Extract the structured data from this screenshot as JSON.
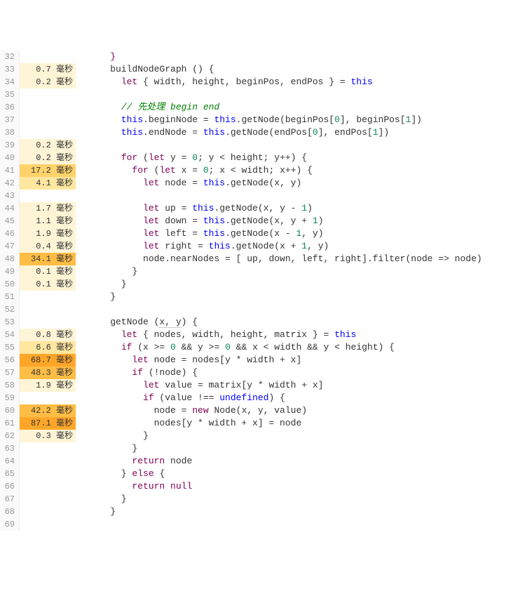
{
  "timing_unit": "毫秒",
  "lines": [
    {
      "n": 32,
      "t": null,
      "heat": 0,
      "tokens": [
        [
          "kw",
          "    }"
        ]
      ]
    },
    {
      "n": 33,
      "t": "0.7",
      "heat": 1,
      "tokens": [
        [
          "id",
          "    buildNodeGraph () {"
        ]
      ]
    },
    {
      "n": 34,
      "t": "0.2",
      "heat": 1,
      "tokens": [
        [
          "plain",
          "      "
        ],
        [
          "kw",
          "let"
        ],
        [
          "plain",
          " { width, height, beginPos, endPos } = "
        ],
        [
          "kw2",
          "this"
        ]
      ]
    },
    {
      "n": 35,
      "t": null,
      "heat": 0,
      "tokens": []
    },
    {
      "n": 36,
      "t": null,
      "heat": 0,
      "tokens": [
        [
          "plain",
          "      "
        ],
        [
          "cmt",
          "// 先处理 begin end"
        ]
      ]
    },
    {
      "n": 37,
      "t": null,
      "heat": 0,
      "tokens": [
        [
          "plain",
          "      "
        ],
        [
          "kw2",
          "this"
        ],
        [
          "plain",
          ".beginNode = "
        ],
        [
          "kw2",
          "this"
        ],
        [
          "plain",
          ".getNode(beginPos["
        ],
        [
          "num",
          "0"
        ],
        [
          "plain",
          "], beginPos["
        ],
        [
          "num",
          "1"
        ],
        [
          "plain",
          "])"
        ]
      ]
    },
    {
      "n": 38,
      "t": null,
      "heat": 0,
      "tokens": [
        [
          "plain",
          "      "
        ],
        [
          "kw2",
          "this"
        ],
        [
          "plain",
          ".endNode = "
        ],
        [
          "kw2",
          "this"
        ],
        [
          "plain",
          ".getNode(endPos["
        ],
        [
          "num",
          "0"
        ],
        [
          "plain",
          "], endPos["
        ],
        [
          "num",
          "1"
        ],
        [
          "plain",
          "])"
        ]
      ]
    },
    {
      "n": 39,
      "t": "0.2",
      "heat": 1,
      "tokens": []
    },
    {
      "n": 40,
      "t": "0.2",
      "heat": 1,
      "tokens": [
        [
          "plain",
          "      "
        ],
        [
          "kw",
          "for"
        ],
        [
          "plain",
          " ("
        ],
        [
          "kw",
          "let"
        ],
        [
          "plain",
          " y = "
        ],
        [
          "num",
          "0"
        ],
        [
          "plain",
          "; y < height; y++) {"
        ]
      ]
    },
    {
      "n": 41,
      "t": "17.2",
      "heat": 3,
      "tokens": [
        [
          "plain",
          "        "
        ],
        [
          "kw",
          "for"
        ],
        [
          "plain",
          " ("
        ],
        [
          "kw",
          "let"
        ],
        [
          "plain",
          " x = "
        ],
        [
          "num",
          "0"
        ],
        [
          "plain",
          "; x < width; x++) {"
        ]
      ]
    },
    {
      "n": 42,
      "t": "4.1",
      "heat": 2,
      "tokens": [
        [
          "plain",
          "          "
        ],
        [
          "kw",
          "let"
        ],
        [
          "plain",
          " node = "
        ],
        [
          "kw2",
          "this"
        ],
        [
          "plain",
          ".getNode(x, y)"
        ]
      ]
    },
    {
      "n": 43,
      "t": null,
      "heat": 0,
      "tokens": []
    },
    {
      "n": 44,
      "t": "1.7",
      "heat": 1,
      "tokens": [
        [
          "plain",
          "          "
        ],
        [
          "kw",
          "let"
        ],
        [
          "plain",
          " up = "
        ],
        [
          "kw2",
          "this"
        ],
        [
          "plain",
          ".getNode(x, y - "
        ],
        [
          "num",
          "1"
        ],
        [
          "plain",
          ")"
        ]
      ]
    },
    {
      "n": 45,
      "t": "1.1",
      "heat": 1,
      "tokens": [
        [
          "plain",
          "          "
        ],
        [
          "kw",
          "let"
        ],
        [
          "plain",
          " down = "
        ],
        [
          "kw2",
          "this"
        ],
        [
          "plain",
          ".getNode(x, y + "
        ],
        [
          "num",
          "1"
        ],
        [
          "plain",
          ")"
        ]
      ]
    },
    {
      "n": 46,
      "t": "1.9",
      "heat": 1,
      "tokens": [
        [
          "plain",
          "          "
        ],
        [
          "kw",
          "let"
        ],
        [
          "plain",
          " left = "
        ],
        [
          "kw2",
          "this"
        ],
        [
          "plain",
          ".getNode(x - "
        ],
        [
          "num",
          "1"
        ],
        [
          "plain",
          ", y)"
        ]
      ]
    },
    {
      "n": 47,
      "t": "0.4",
      "heat": 1,
      "tokens": [
        [
          "plain",
          "          "
        ],
        [
          "kw",
          "let"
        ],
        [
          "plain",
          " right = "
        ],
        [
          "kw2",
          "this"
        ],
        [
          "plain",
          ".getNode(x + "
        ],
        [
          "num",
          "1"
        ],
        [
          "plain",
          ", y)"
        ]
      ]
    },
    {
      "n": 48,
      "t": "34.1",
      "heat": 4,
      "tokens": [
        [
          "plain",
          "          node.nearNodes = [ up, down, left, right].filter(node => node)"
        ]
      ]
    },
    {
      "n": 49,
      "t": "0.1",
      "heat": 1,
      "tokens": [
        [
          "plain",
          "        }"
        ]
      ]
    },
    {
      "n": 50,
      "t": "0.1",
      "heat": 1,
      "tokens": [
        [
          "plain",
          "      }"
        ]
      ]
    },
    {
      "n": 51,
      "t": null,
      "heat": 0,
      "tokens": [
        [
          "plain",
          "    }"
        ]
      ]
    },
    {
      "n": 52,
      "t": null,
      "heat": 0,
      "tokens": []
    },
    {
      "n": 53,
      "t": null,
      "heat": 0,
      "tokens": [
        [
          "plain",
          "    getNode ("
        ],
        [
          "param",
          "x, y"
        ],
        [
          "plain",
          ") {"
        ]
      ]
    },
    {
      "n": 54,
      "t": "0.8",
      "heat": 1,
      "tokens": [
        [
          "plain",
          "      "
        ],
        [
          "kw",
          "let"
        ],
        [
          "plain",
          " { nodes, width, height, matrix } = "
        ],
        [
          "kw2",
          "this"
        ]
      ]
    },
    {
      "n": 55,
      "t": "6.6",
      "heat": 2,
      "tokens": [
        [
          "plain",
          "      "
        ],
        [
          "kw",
          "if"
        ],
        [
          "plain",
          " (x >= "
        ],
        [
          "num",
          "0"
        ],
        [
          "plain",
          " && y >= "
        ],
        [
          "num",
          "0"
        ],
        [
          "plain",
          " && x < width && y < height) {"
        ]
      ]
    },
    {
      "n": 56,
      "t": "68.7",
      "heat": 5,
      "tokens": [
        [
          "plain",
          "        "
        ],
        [
          "kw",
          "let"
        ],
        [
          "plain",
          " node = nodes[y * width + x]"
        ]
      ]
    },
    {
      "n": 57,
      "t": "48.3",
      "heat": 4,
      "tokens": [
        [
          "plain",
          "        "
        ],
        [
          "kw",
          "if"
        ],
        [
          "plain",
          " (!node) {"
        ]
      ]
    },
    {
      "n": 58,
      "t": "1.9",
      "heat": 1,
      "tokens": [
        [
          "plain",
          "          "
        ],
        [
          "kw",
          "let"
        ],
        [
          "plain",
          " value = matrix[y * width + x]"
        ]
      ]
    },
    {
      "n": 59,
      "t": null,
      "heat": 0,
      "tokens": [
        [
          "plain",
          "          "
        ],
        [
          "kw",
          "if"
        ],
        [
          "plain",
          " (value !== "
        ],
        [
          "undef",
          "undefined"
        ],
        [
          "plain",
          ") {"
        ]
      ]
    },
    {
      "n": 60,
      "t": "42.2",
      "heat": 4,
      "tokens": [
        [
          "plain",
          "            node = "
        ],
        [
          "kw",
          "new"
        ],
        [
          "plain",
          " Node(x, y, value)"
        ]
      ]
    },
    {
      "n": 61,
      "t": "87.1",
      "heat": 5,
      "tokens": [
        [
          "plain",
          "            nodes[y * width + x] = node"
        ]
      ]
    },
    {
      "n": 62,
      "t": "0.3",
      "heat": 1,
      "tokens": [
        [
          "plain",
          "          }"
        ]
      ]
    },
    {
      "n": 63,
      "t": null,
      "heat": 0,
      "tokens": [
        [
          "plain",
          "        }"
        ]
      ]
    },
    {
      "n": 64,
      "t": null,
      "heat": 0,
      "tokens": [
        [
          "plain",
          "        "
        ],
        [
          "kw",
          "return"
        ],
        [
          "plain",
          " node"
        ]
      ]
    },
    {
      "n": 65,
      "t": null,
      "heat": 0,
      "tokens": [
        [
          "plain",
          "      } "
        ],
        [
          "kw",
          "else"
        ],
        [
          "plain",
          " {"
        ]
      ]
    },
    {
      "n": 66,
      "t": null,
      "heat": 0,
      "tokens": [
        [
          "plain",
          "        "
        ],
        [
          "kw",
          "return"
        ],
        [
          "plain",
          " "
        ],
        [
          "kw",
          "null"
        ]
      ]
    },
    {
      "n": 67,
      "t": null,
      "heat": 0,
      "tokens": [
        [
          "plain",
          "      }"
        ]
      ]
    },
    {
      "n": 68,
      "t": null,
      "heat": 0,
      "tokens": [
        [
          "plain",
          "    }"
        ]
      ]
    },
    {
      "n": 69,
      "t": null,
      "heat": 0,
      "tokens": []
    }
  ]
}
